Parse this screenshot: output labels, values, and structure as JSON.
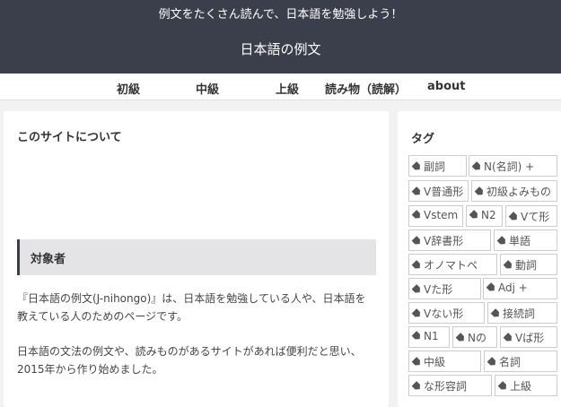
{
  "header": {
    "tagline": "例文をたくさん読んで、日本語を勉強しよう！",
    "site_title": "日本語の例文"
  },
  "nav": [
    "初級",
    "中級",
    "上級",
    "読み物（読解）",
    "about"
  ],
  "main": {
    "title": "このサイトについて",
    "section_heading": "対象者",
    "para1": [
      "『日本語の例文(J-nihongo)』は、日本語を勉強している人や、日本語を",
      "教えている人のためのページです。"
    ],
    "para2": [
      "日本語の文法の例文や、読みものがあるサイトがあれば便利だと思い、",
      "2015年から作り始めました。"
    ]
  },
  "sidebar": {
    "title": "タグ",
    "tags": [
      "副詞",
      "N(名詞) +",
      "V普通形",
      "初級よみもの",
      "Vstem",
      "N2",
      "Vて形",
      "V辞書形",
      "単語",
      "オノマトペ",
      "動詞",
      "Vた形",
      "Adj +",
      "Vない形",
      "接続詞",
      "N1",
      "Nの",
      "Vば形",
      "中級",
      "名詞",
      "な形容詞",
      "上級"
    ]
  }
}
